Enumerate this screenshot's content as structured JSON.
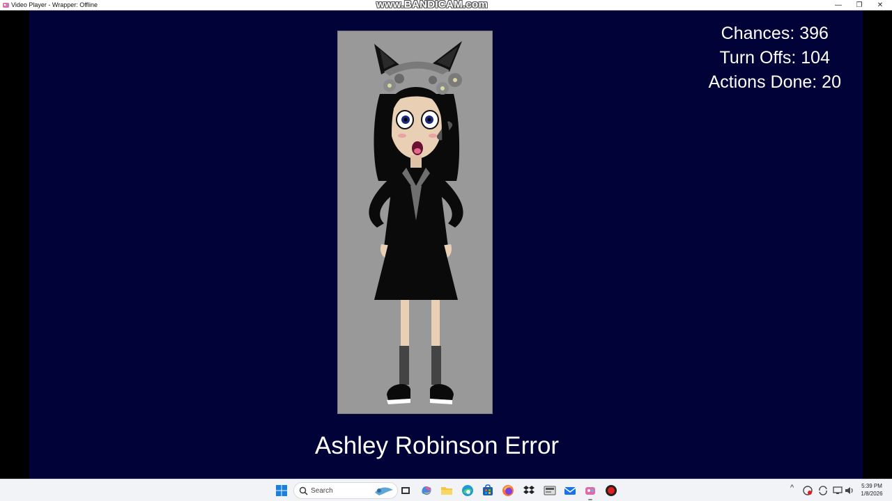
{
  "window": {
    "title": "Video Player - Wrapper: Offline",
    "watermark": "www.BANDICAM.com",
    "controls": {
      "minimize": "—",
      "maximize": "❐",
      "close": "✕"
    }
  },
  "video": {
    "stats": {
      "chances": "Chances: 396",
      "turn_offs": "Turn Offs: 104",
      "actions_done": "Actions Done: 20"
    },
    "caption": "Ashley Robinson Error",
    "colors": {
      "background": "#000238",
      "portrait_bg": "#999999",
      "text": "#ffffff"
    }
  },
  "taskbar": {
    "search_placeholder": "Search",
    "apps": [
      "start-icon",
      "search-icon",
      "widgets-icon",
      "task-view-icon",
      "copilot-icon",
      "file-explorer-icon",
      "edge-icon",
      "store-icon",
      "firefox-icon",
      "dropbox-icon",
      "app-icon",
      "mail-icon",
      "wrapper-app-icon",
      "bandicam-record-icon"
    ],
    "tray": {
      "chevron": "^",
      "time": "5:39 PM",
      "date": "1/8/2026"
    }
  }
}
